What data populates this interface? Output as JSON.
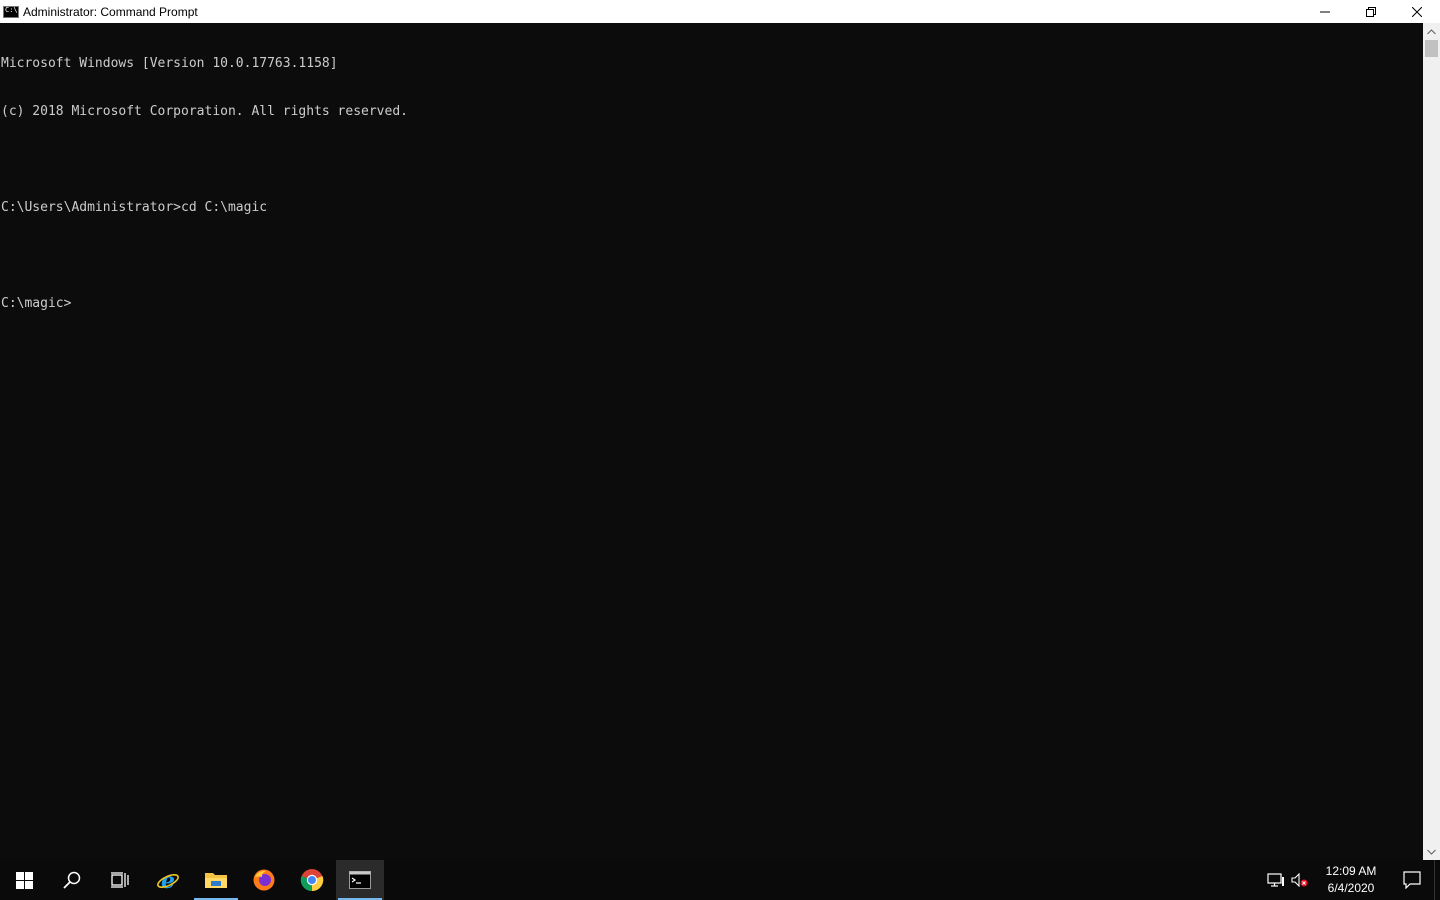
{
  "window": {
    "title": "Administrator: Command Prompt",
    "controls": {
      "minimize": "—",
      "restore": "❐",
      "close": "✕"
    }
  },
  "console": {
    "lines": [
      "Microsoft Windows [Version 10.0.17763.1158]",
      "(c) 2018 Microsoft Corporation. All rights reserved.",
      "",
      "C:\\Users\\Administrator>cd C:\\magic",
      "",
      "C:\\magic>"
    ],
    "text_color": "#cccccc",
    "background_color": "#0c0c0c"
  },
  "taskbar": {
    "items": [
      {
        "name": "start-button",
        "icon": "windows-logo-icon"
      },
      {
        "name": "search-button",
        "icon": "search-icon"
      },
      {
        "name": "task-view-button",
        "icon": "task-view-icon"
      },
      {
        "name": "internet-explorer-button",
        "icon": "internet-explorer-icon"
      },
      {
        "name": "file-explorer-button",
        "icon": "folder-icon"
      },
      {
        "name": "firefox-button",
        "icon": "firefox-icon"
      },
      {
        "name": "chrome-button",
        "icon": "chrome-icon"
      },
      {
        "name": "command-prompt-button",
        "icon": "command-prompt-icon"
      }
    ],
    "accent_color": "#76b9ed",
    "clock": {
      "time": "12:09 AM",
      "date": "6/4/2020"
    }
  }
}
